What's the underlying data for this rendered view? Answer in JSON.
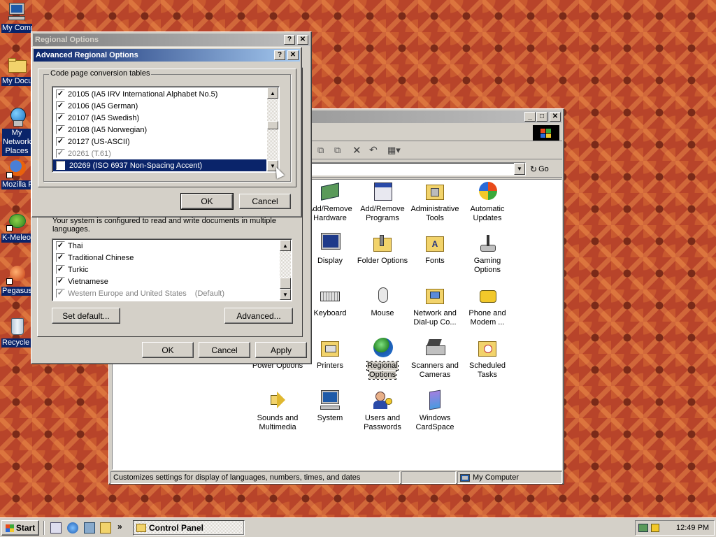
{
  "desktop": {
    "icons": [
      {
        "label": "My Computer"
      },
      {
        "label": "My Documents"
      },
      {
        "label": "My Network Places"
      },
      {
        "label": "Mozilla Firefox"
      },
      {
        "label": "K-Meleon"
      },
      {
        "label": "Pegasus"
      },
      {
        "label": "Recycle Bin"
      }
    ]
  },
  "control_panel": {
    "go_label": "Go",
    "status_text": "Customizes settings for display of languages, numbers, times, and dates",
    "status_location": "My Computer",
    "items": [
      {
        "label": "Add/Remove Hardware"
      },
      {
        "label": "Add/Remove Programs"
      },
      {
        "label": "Administrative Tools"
      },
      {
        "label": "Automatic Updates"
      },
      {
        "label": "Display"
      },
      {
        "label": "Folder Options"
      },
      {
        "label": "Fonts"
      },
      {
        "label": "Gaming Options"
      },
      {
        "label": "Keyboard"
      },
      {
        "label": "Mouse"
      },
      {
        "label": "Network and Dial-up Co..."
      },
      {
        "label": "Phone and Modem ..."
      },
      {
        "label": "Power Options"
      },
      {
        "label": "Printers"
      },
      {
        "label": "Regional Options"
      },
      {
        "label": "Scanners and Cameras"
      },
      {
        "label": "Scheduled Tasks"
      },
      {
        "label": "Sounds and Multimedia"
      },
      {
        "label": "System"
      },
      {
        "label": "Users and Passwords"
      },
      {
        "label": "Windows CardSpace"
      }
    ]
  },
  "regional": {
    "title": "Regional Options",
    "info_text": "Your system is configured to read and write documents in multiple languages.",
    "languages": [
      {
        "label": "Thai",
        "checked": true
      },
      {
        "label": "Traditional Chinese",
        "checked": true
      },
      {
        "label": "Turkic",
        "checked": true
      },
      {
        "label": "Vietnamese",
        "checked": true
      },
      {
        "label": "Western Europe and United States",
        "suffix": "(Default)",
        "checked": true,
        "disabled": true
      }
    ],
    "set_default": "Set default...",
    "advanced": "Advanced...",
    "ok": "OK",
    "cancel": "Cancel",
    "apply": "Apply"
  },
  "advanced": {
    "title": "Advanced Regional Options",
    "group_label": "Code page conversion tables",
    "tables": [
      {
        "label": "20105 (IA5 IRV International Alphabet No.5)",
        "checked": true
      },
      {
        "label": "20106 (IA5 German)",
        "checked": true
      },
      {
        "label": "20107 (IA5 Swedish)",
        "checked": true
      },
      {
        "label": "20108 (IA5 Norwegian)",
        "checked": true
      },
      {
        "label": "20127 (US-ASCII)",
        "checked": true
      },
      {
        "label": "20261 (T.61)",
        "checked": true,
        "disabled": true
      },
      {
        "label": "20269 (ISO 6937 Non-Spacing Accent)",
        "checked": true,
        "selected": true
      }
    ],
    "ok": "OK",
    "cancel": "Cancel"
  },
  "taskbar": {
    "start_label": "Start",
    "task_label": "Control Panel",
    "clock": "12:49 PM"
  }
}
